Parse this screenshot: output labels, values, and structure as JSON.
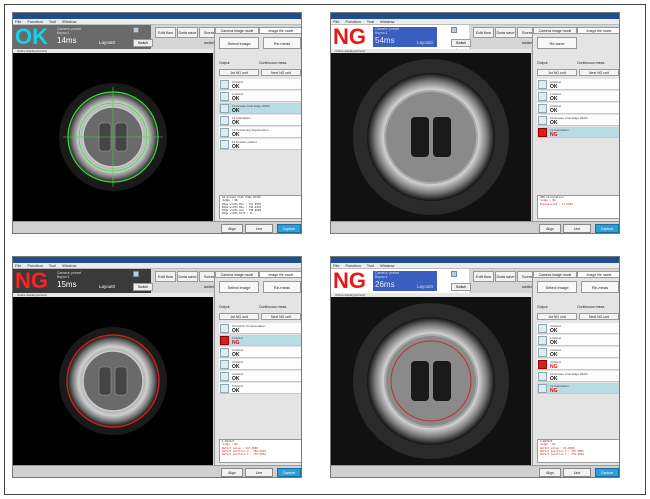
{
  "menu": [
    "File",
    "Function",
    "Tool",
    "Window"
  ],
  "panels": [
    {
      "id": "top-left",
      "status": "OK",
      "status_style": "ok",
      "info_lines": [
        "Camera: preset",
        "Bsync:1"
      ],
      "time": "14ms",
      "layout_label": "Layout0",
      "toolbar": [
        "Edit flow",
        "Data save",
        "Scene switch"
      ],
      "switch_label": "Switch layout",
      "image_label": "Online display(current)",
      "tabs": [
        "Camera image mode",
        "Image file mode"
      ],
      "btn_select": "Select image",
      "btn_remeas": "Re-meas",
      "opts": [
        "Output",
        "Continuous meas."
      ],
      "subtabs": [
        "1st NG unit",
        "Next NG unit"
      ],
      "tools": [
        {
          "name": "0.Defect",
          "result": "OK",
          "hl": false,
          "red": false
        },
        {
          "name": "1.Defect",
          "result": "OK",
          "hl": false,
          "red": false
        },
        {
          "name": "10.Grease Coat Edge Width",
          "result": "OK",
          "hl": true,
          "red": false
        },
        {
          "name": "11.Calculation",
          "result": "OK",
          "hl": false,
          "red": false
        },
        {
          "name": "12.Positioning Suppression",
          "result": "OK",
          "hl": false,
          "red": false
        },
        {
          "name": "13.Position pattern",
          "result": "OK",
          "hl": false,
          "red": false
        }
      ],
      "log": [
        "10.Grease Coat Edge Width",
        "Judge : OK",
        "Edge width Min : 731.9976",
        "Edge width Max : 745.0476",
        "Edge width Ave : 738.6628",
        "Edge width Diff : 8"
      ],
      "log_red": [],
      "bottom": [
        "Align",
        "Line",
        "Capture"
      ]
    },
    {
      "id": "top-right",
      "status": "NG",
      "status_style": "ng-b",
      "info_lines": [
        "Camera: preset",
        "Bsync:1"
      ],
      "time": "54ms",
      "layout_label": "Layout0",
      "toolbar": [
        "Edit flow",
        "Data save",
        "Scene switch"
      ],
      "switch_label": "Switch layout",
      "image_label": "Online display(current)",
      "tabs": [
        "Camera image mode",
        "Image file mode"
      ],
      "btn_select": "Re-save",
      "btn_remeas": "",
      "opts": [
        "Output",
        "Continuous meas."
      ],
      "subtabs": [
        "1st NG unit",
        "Next NG unit"
      ],
      "tools": [
        {
          "name": "0.Defect",
          "result": "OK",
          "hl": false,
          "red": false
        },
        {
          "name": "1.Defect",
          "result": "OK",
          "hl": false,
          "red": false
        },
        {
          "name": "2.Defect",
          "result": "OK",
          "hl": false,
          "red": false
        },
        {
          "name": "10.Grease Coat Edge Width",
          "result": "OK",
          "hl": false,
          "red": false
        },
        {
          "name": "11.Calculation",
          "result": "NG",
          "hl": true,
          "red": true
        }
      ],
      "log": [
        "200.Calculation"
      ],
      "log_red": [
        "Judge : NG",
        "Expression0 : 11.0000"
      ],
      "bottom": [
        "Align",
        "Line",
        "Capture"
      ]
    },
    {
      "id": "bottom-left",
      "status": "NG",
      "status_style": "ng-a",
      "info_lines": [
        "Camera: preset",
        "Bsync:1"
      ],
      "time": "15ms",
      "layout_label": "Layout0",
      "toolbar": [
        "Edit flow",
        "Data save",
        "Scene switch"
      ],
      "switch_label": "Switch layout",
      "image_label": "Online display(current)",
      "tabs": [
        "Camera image mode",
        "Image file mode"
      ],
      "btn_select": "Select image",
      "btn_remeas": "Re-meas",
      "opts": [
        "Output",
        "Continuous meas."
      ],
      "subtabs": [
        "1st NG unit",
        "Next NG unit"
      ],
      "tools": [
        {
          "name": "0.Position Compensation",
          "result": "OK",
          "hl": false,
          "red": false
        },
        {
          "name": "1.Defect",
          "result": "NG",
          "hl": true,
          "red": true
        },
        {
          "name": "2.Defect",
          "result": "OK",
          "hl": false,
          "red": false
        },
        {
          "name": "3.Defect",
          "result": "OK",
          "hl": false,
          "red": false
        },
        {
          "name": "4.Defect",
          "result": "OK",
          "hl": false,
          "red": false
        },
        {
          "name": "5.Defect",
          "result": "OK",
          "hl": false,
          "red": false
        }
      ],
      "log": [
        "1.Defect"
      ],
      "log_red": [
        "Judge : NG",
        "Defect value : 347.0000",
        "Defect position X : 348.6649",
        "Defect position Y : 770.2834"
      ],
      "bottom": [
        "Align",
        "Line",
        "Capture"
      ]
    },
    {
      "id": "bottom-right",
      "status": "NG",
      "status_style": "ng-b",
      "info_lines": [
        "Camera: preset",
        "Bsync:1"
      ],
      "time": "26ms",
      "layout_label": "Layout0",
      "toolbar": [
        "Edit flow",
        "Data save",
        "Scene switch"
      ],
      "switch_label": "Switch layout",
      "image_label": "Online display(current)",
      "tabs": [
        "Camera image mode",
        "Image file mode"
      ],
      "btn_select": "Select image",
      "btn_remeas": "Re-meas",
      "opts": [
        "Output",
        "Continuous meas."
      ],
      "subtabs": [
        "1st NG unit",
        "Next NG unit"
      ],
      "tools": [
        {
          "name": "0.Defect",
          "result": "OK",
          "hl": false,
          "red": false
        },
        {
          "name": "1.Defect",
          "result": "OK",
          "hl": false,
          "red": false
        },
        {
          "name": "2.Defect",
          "result": "OK",
          "hl": false,
          "red": false
        },
        {
          "name": "3.Defect",
          "result": "NG",
          "hl": false,
          "red": true
        },
        {
          "name": "10.Grease Coat Edge Width",
          "result": "OK",
          "hl": false,
          "red": false
        },
        {
          "name": "11.Calculation",
          "result": "NG",
          "hl": true,
          "red": false
        }
      ],
      "log": [
        "3.Defect"
      ],
      "log_red": [
        "Judge : NG",
        "Defect value : 81.0000",
        "Defect position X : 376.5855",
        "Defect position Y : 776.2834"
      ],
      "bottom": [
        "Align",
        "Line",
        "Capture"
      ]
    }
  ]
}
